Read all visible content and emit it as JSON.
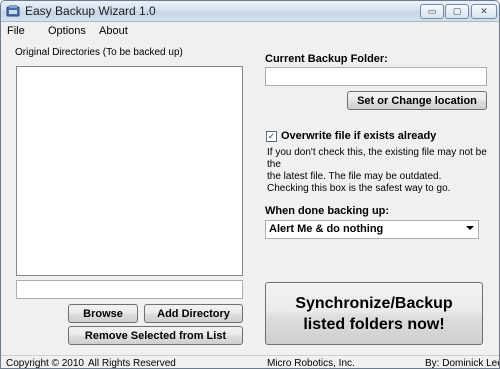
{
  "window": {
    "title": "Easy Backup Wizard 1.0",
    "controls": {
      "minimize": "▭",
      "maximize": "▢",
      "close": "✕"
    }
  },
  "menu": [
    "File",
    "Options",
    "About"
  ],
  "left_panel": {
    "list_label": "Original Directories (To be backed up)",
    "path_input_value": "",
    "buttons": {
      "browse": "Browse",
      "add_directory": "Add Directory",
      "remove_selected": "Remove Selected from List"
    }
  },
  "right_panel": {
    "current_backup_label": "Current Backup Folder:",
    "backup_folder_value": "",
    "set_location_button": "Set or Change location",
    "overwrite_checked": true,
    "overwrite_label": "Overwrite file if exists already",
    "help_lines": [
      "If you don't check this, the existing file may not be the",
      "the latest file. The file may be outdated.",
      "Checking this box is the safest way to go."
    ],
    "when_done_label": "When done backing up:",
    "when_done_selected": "Alert Me & do nothing",
    "sync_button_line1": "Synchronize/Backup",
    "sync_button_line2": "listed folders now!"
  },
  "statusbar": {
    "copyright": "Copyright © 2010",
    "rights": "All Rights Reserved",
    "company": "Micro Robotics, Inc.",
    "author": "By:  Dominick Lee"
  },
  "icons": {
    "app": "app-icon",
    "dropdown": "chevron-down-icon",
    "check": "checkmark-icon"
  }
}
